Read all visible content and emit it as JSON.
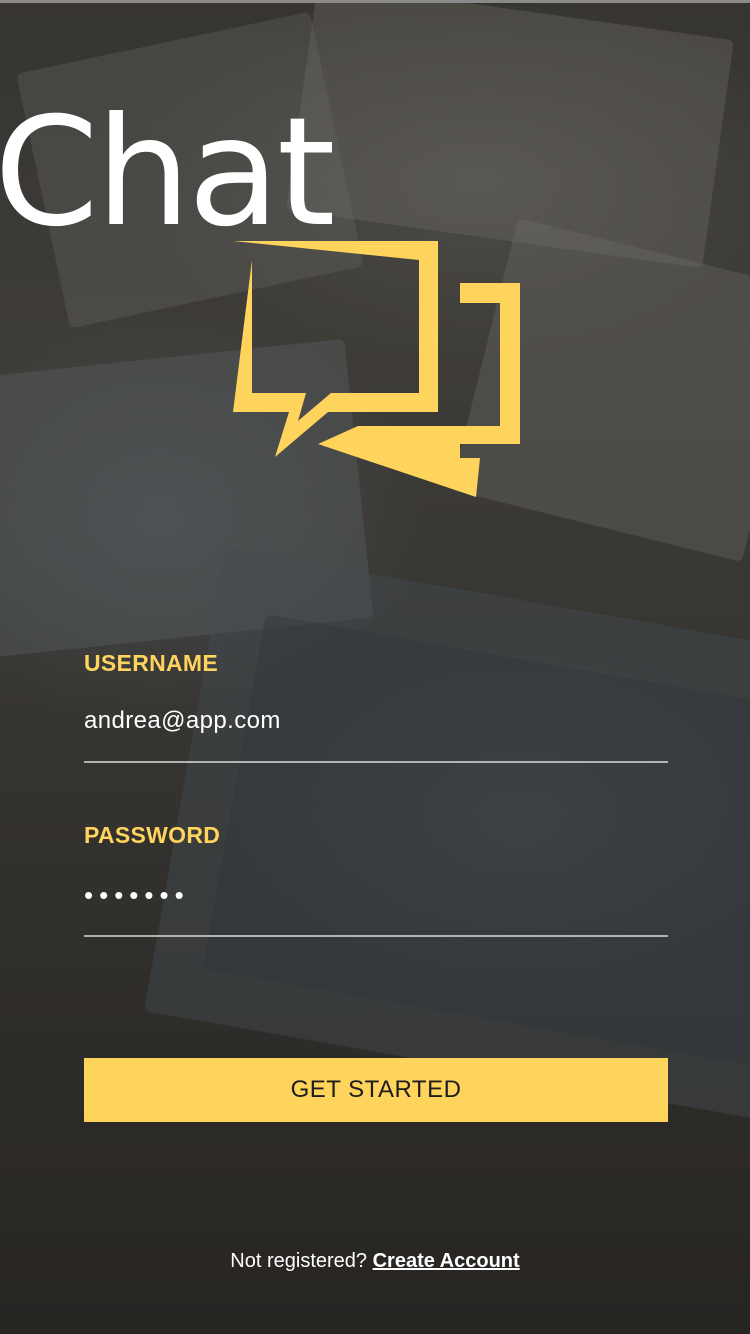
{
  "app": {
    "title": "Chat",
    "logo_icon": "chat-bubbles-icon",
    "accent_color": "#ffd45c"
  },
  "form": {
    "username": {
      "label": "USERNAME",
      "value": "andrea@app.com"
    },
    "password": {
      "label": "PASSWORD",
      "value": "•••••••"
    }
  },
  "actions": {
    "get_started_label": "GET STARTED"
  },
  "footer": {
    "prompt": "Not registered?",
    "link_label": "Create Account"
  }
}
